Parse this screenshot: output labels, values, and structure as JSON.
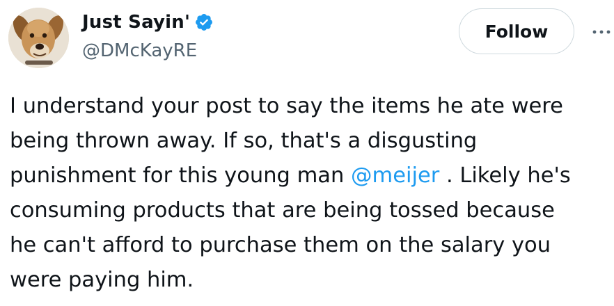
{
  "author": {
    "display_name": "Just Sayin'",
    "handle": "@DMcKayRE",
    "verified": true
  },
  "follow_button": {
    "label": "Follow"
  },
  "tweet": {
    "text_before_mention": "I understand your post to say the items he ate were\nbeing thrown away. If so, that's a disgusting\npunishment for this young man ",
    "mention": "@meijer",
    "text_after_mention": " . Likely he's\nconsuming products that are being tossed because\nhe can't afford to purchase them on the salary you\nwere paying him."
  },
  "icons": {
    "avatar": "dog-avatar",
    "verified": "verified-badge-icon",
    "more": "more-options-icon"
  },
  "colors": {
    "text": "#0f1419",
    "secondary_text": "#536471",
    "accent": "#1d9bf0",
    "button_border": "#cfd9de"
  }
}
